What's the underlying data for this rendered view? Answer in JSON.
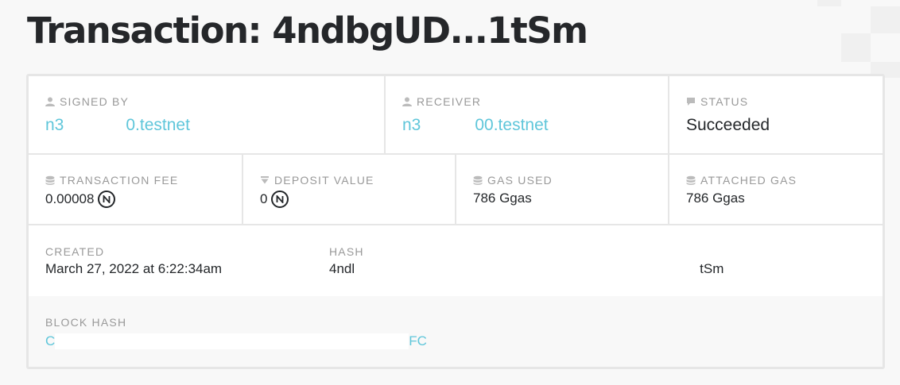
{
  "page": {
    "title": "Transaction: 4ndbgUD...1tSm"
  },
  "fields": {
    "signed_by": {
      "label": "SIGNED BY",
      "value_start": "n3",
      "value_end": "0.testnet"
    },
    "receiver": {
      "label": "RECEIVER",
      "value_start": "n3",
      "value_end": "00.testnet"
    },
    "status": {
      "label": "STATUS",
      "value": "Succeeded"
    },
    "transaction_fee": {
      "label": "TRANSACTION FEE",
      "value": "0.00008"
    },
    "deposit_value": {
      "label": "DEPOSIT VALUE",
      "value": "0"
    },
    "gas_used": {
      "label": "GAS USED",
      "value": "786 Ggas"
    },
    "attached_gas": {
      "label": "ATTACHED GAS",
      "value": "786 Ggas"
    },
    "created": {
      "label": "CREATED",
      "value": "March 27, 2022 at 6:22:34am"
    },
    "hash": {
      "label": "HASH",
      "value_start": "4ndl",
      "value_end": "tSm"
    },
    "block_hash": {
      "label": "BLOCK HASH",
      "value_start": "C",
      "value_end": "FC"
    }
  },
  "colors": {
    "link": "#5fc6da",
    "label": "#999999",
    "text": "#24272a",
    "border": "#e6e6e6"
  },
  "icons": {
    "account": "user-icon",
    "status": "chat-bubble-icon",
    "fee": "coins-icon",
    "deposit": "filter-icon",
    "near_token": "near-token-icon"
  }
}
